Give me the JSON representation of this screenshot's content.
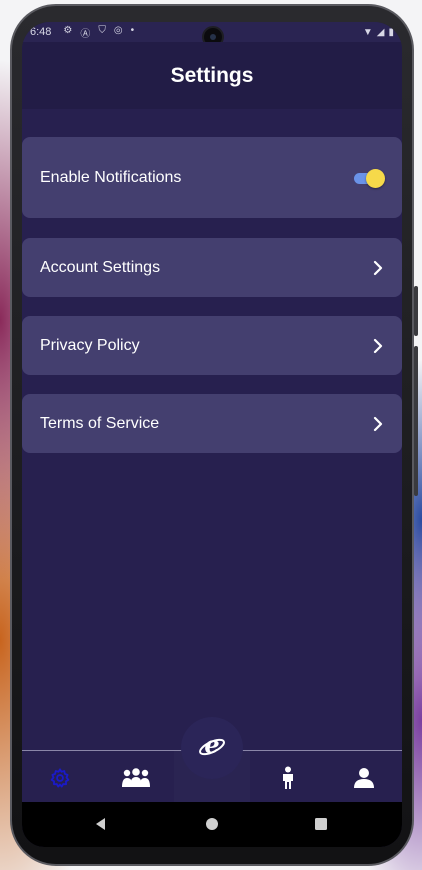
{
  "status_bar": {
    "time": "6:48",
    "icons": [
      "gear-icon",
      "a-icon",
      "shield-icon",
      "data-saver-icon",
      "dot-icon"
    ],
    "right_icons": [
      "wifi-icon",
      "signal-icon",
      "battery-icon"
    ]
  },
  "header": {
    "title": "Settings"
  },
  "settings": {
    "notifications": {
      "label": "Enable Notifications",
      "enabled": true
    },
    "items": [
      {
        "label": "Account Settings"
      },
      {
        "label": "Privacy Policy"
      },
      {
        "label": "Terms of Service"
      }
    ]
  },
  "bottom_nav": {
    "items": [
      "settings-icon",
      "group-icon",
      "explorer-icon",
      "person-icon",
      "user-icon"
    ],
    "active": "settings-icon",
    "active_color": "#1a1ac8"
  },
  "system_nav": [
    "back-icon",
    "home-icon",
    "recents-icon"
  ],
  "colors": {
    "background": "#27204f",
    "header": "#221c46",
    "card": "#443f6f",
    "toggle_track": "#6a93e8",
    "toggle_thumb": "#f6d94a"
  }
}
